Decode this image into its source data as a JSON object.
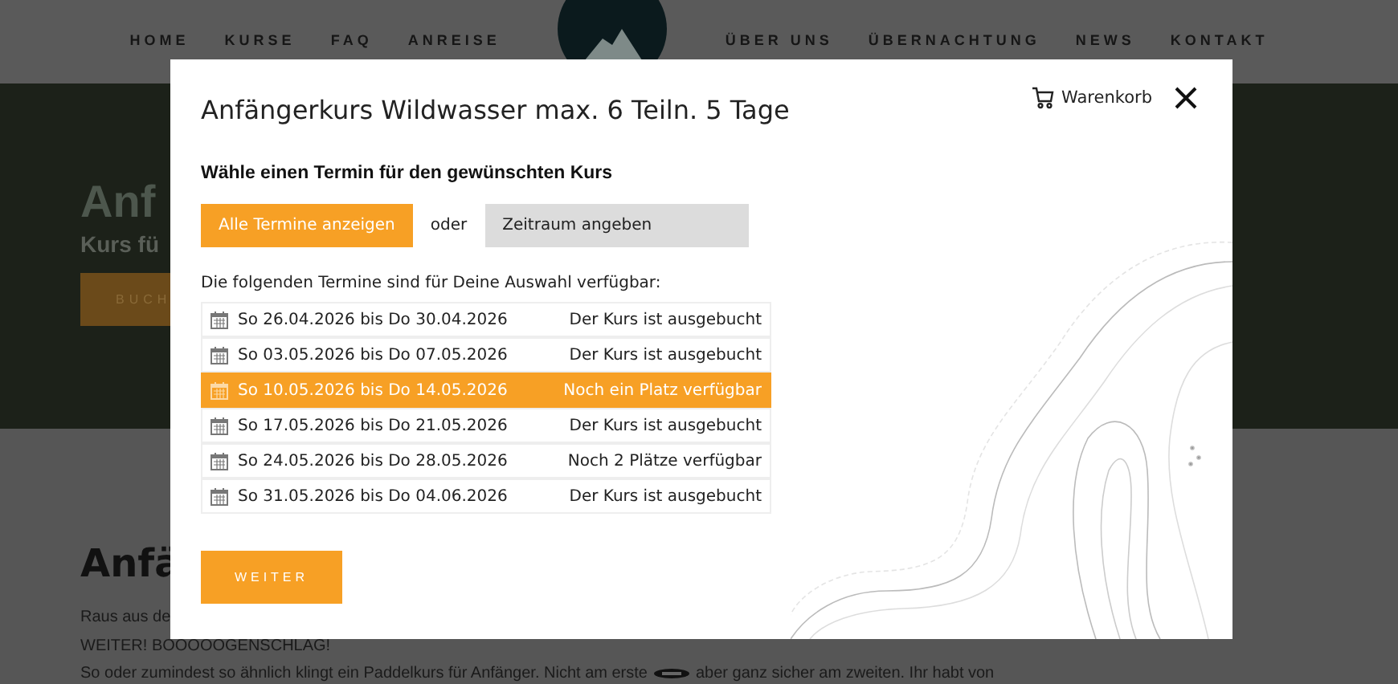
{
  "nav": {
    "left": [
      "HOME",
      "KURSE",
      "FAQ",
      "ANREISE"
    ],
    "right": [
      "ÜBER UNS",
      "ÜBERNACHTUNG",
      "NEWS",
      "KONTAKT"
    ]
  },
  "hero": {
    "title": "Anf",
    "subtitle": "Kurs fü",
    "button": "BUCH"
  },
  "content": {
    "heading": "Anfä",
    "lines": [
      "Raus aus de",
      "WEITER! BOOOOOGENSCHLAG!"
    ],
    "paragraph_start": "So oder zumindest so ähnlich klingt ein Paddelkurs für Anfänger. Nicht am erste",
    "paragraph_end": "aber ganz sicher am zweiten. Ihr habt von"
  },
  "modal": {
    "title": "Anfängerkurs Wildwasser max. 6 Teiln. 5 Tage",
    "cart": "Warenkorb",
    "subtitle": "Wähle einen Termin für den gewünschten Kurs",
    "filters": [
      {
        "label": "Alle Termine anzeigen",
        "selected": true
      },
      {
        "label": "Zeitraum angeben",
        "selected": false
      }
    ],
    "or": "oder",
    "info": "Die folgenden Termine sind für Deine Auswahl verfügbar:",
    "dates": [
      {
        "range": "So 26.04.2026 bis Do 30.04.2026",
        "status": "Der Kurs ist ausgebucht",
        "selected": false
      },
      {
        "range": "So 03.05.2026 bis Do 07.05.2026",
        "status": "Der Kurs ist ausgebucht",
        "selected": false
      },
      {
        "range": "So 10.05.2026 bis Do 14.05.2026",
        "status": "Noch ein Platz verfügbar",
        "selected": true
      },
      {
        "range": "So 17.05.2026 bis Do 21.05.2026",
        "status": "Der Kurs ist ausgebucht",
        "selected": false
      },
      {
        "range": "So 24.05.2026 bis Do 28.05.2026",
        "status": "Noch 2 Plätze verfügbar",
        "selected": false
      },
      {
        "range": "So 31.05.2026 bis Do 04.06.2026",
        "status": "Der Kurs ist ausgebucht",
        "selected": false
      }
    ],
    "next_button": "WEITER"
  }
}
